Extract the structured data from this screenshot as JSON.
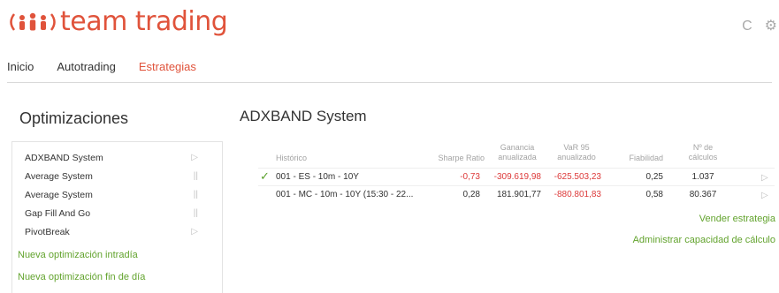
{
  "app": {
    "brand": "team trading",
    "brand_color": "#e0533b",
    "accent_green": "#62a32d"
  },
  "header_icons": [
    {
      "name": "refresh-icon",
      "glyph": "C"
    },
    {
      "name": "gear-icon",
      "glyph": "⚙"
    }
  ],
  "nav": {
    "items": [
      "Inicio",
      "Autotrading",
      "Estrategias"
    ],
    "active_index": 2
  },
  "sidebar": {
    "title": "Optimizaciones",
    "items": [
      {
        "label": "ADXBAND System",
        "marker": "▷",
        "state": "play"
      },
      {
        "label": "Average System",
        "marker": "||",
        "state": "pause"
      },
      {
        "label": "Average System",
        "marker": "||",
        "state": "pause"
      },
      {
        "label": "Gap Fill And Go",
        "marker": "||",
        "state": "pause"
      },
      {
        "label": "PivotBreak",
        "marker": "▷",
        "state": "play"
      }
    ],
    "links": [
      "Nueva optimización intradía",
      "Nueva optimización fin de día"
    ]
  },
  "main": {
    "title": "ADXBAND System",
    "columns": {
      "historico": "Histórico",
      "sharpe": "Sharpe Ratio",
      "ganancia_1": "Ganancia",
      "ganancia_2": "anualizada",
      "var_1": "VaR 95",
      "var_2": "anualizado",
      "fiabilidad": "Fiabilidad",
      "calculos_1": "Nº de",
      "calculos_2": "cálculos"
    },
    "rows": [
      {
        "checked": true,
        "historico": "001 - ES - 10m - 10Y",
        "sharpe": "-0,73",
        "ganancia": "-309.619,98",
        "var": "-625.503,23",
        "fiabilidad": "0,25",
        "calculos": "1.037"
      },
      {
        "checked": false,
        "historico": "001 - MC - 10m - 10Y  (15:30 - 22...",
        "sharpe": "0,28",
        "ganancia": "181.901,77",
        "var": "-880.801,83",
        "fiabilidad": "0,58",
        "calculos": "80.367"
      }
    ],
    "actions": [
      "Vender estrategia",
      "Administrar capacidad de cálculo"
    ]
  }
}
